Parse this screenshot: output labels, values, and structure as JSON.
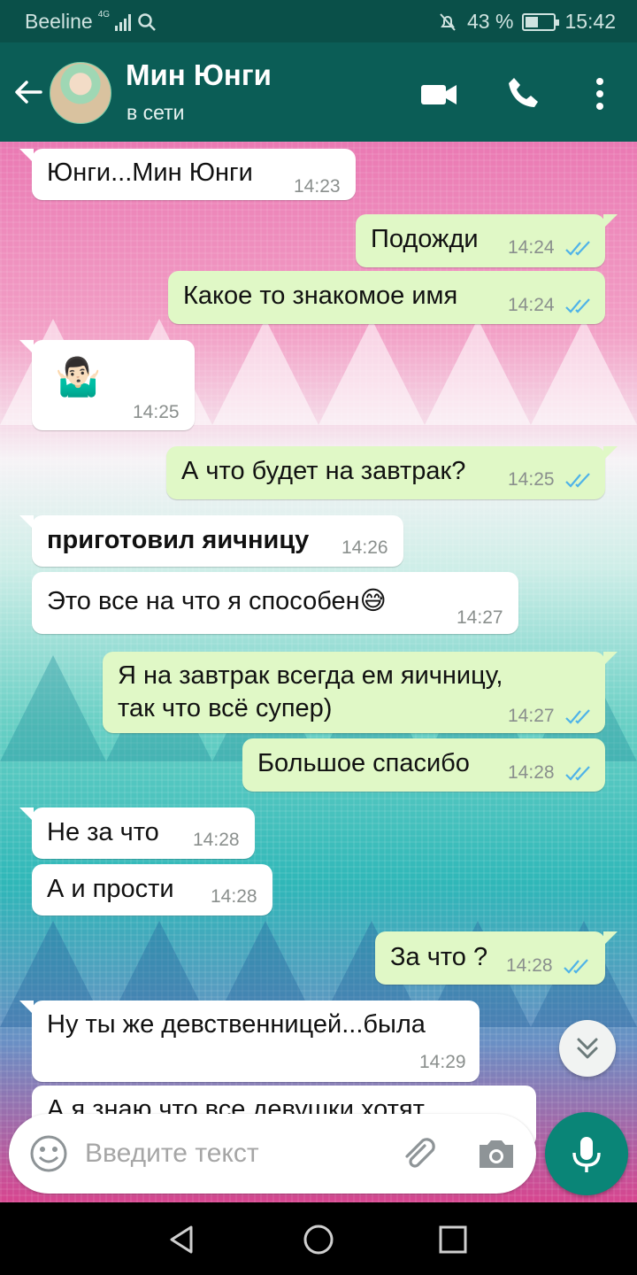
{
  "status_bar": {
    "carrier": "Beeline",
    "network": "4G",
    "battery": "43 %",
    "time": "15:42"
  },
  "header": {
    "name": "Мин Юнги",
    "status": "в сети"
  },
  "messages": [
    {
      "dir": "in",
      "text": "Юнги...Мин Юнги",
      "time": "14:23"
    },
    {
      "dir": "out",
      "text": "Подожди",
      "time": "14:24",
      "read": true
    },
    {
      "dir": "out",
      "text": "Какое то знакомое имя",
      "time": "14:24",
      "read": true
    },
    {
      "dir": "in",
      "text": "🤷🏻‍♂️",
      "time": "14:25"
    },
    {
      "dir": "out",
      "text": "А что будет на завтрак?",
      "time": "14:25",
      "read": true
    },
    {
      "dir": "in",
      "text": "приготовил яичницу",
      "time": "14:26"
    },
    {
      "dir": "in",
      "text": "Это все на что я способен😅",
      "time": "14:27"
    },
    {
      "dir": "out",
      "text_line1": "Я на завтрак всегда ем яичницу,",
      "text_line2": "так что всё супер)",
      "time": "14:27",
      "read": true
    },
    {
      "dir": "out",
      "text": "Большое спасибо",
      "time": "14:28",
      "read": true
    },
    {
      "dir": "in",
      "text": "Не за что",
      "time": "14:28"
    },
    {
      "dir": "in",
      "text": "А и прости",
      "time": "14:28"
    },
    {
      "dir": "out",
      "text": "За что ?",
      "time": "14:28",
      "read": true
    },
    {
      "dir": "in",
      "text": "Ну ты же девственницей...была",
      "time": "14:29"
    },
    {
      "dir": "in",
      "text": "А я знаю что все девушки хотят",
      "time": ""
    }
  ],
  "input": {
    "placeholder": "Введите текст"
  },
  "colors": {
    "header": "#0b5d56",
    "outgoing_bubble": "#e0f8c6",
    "incoming_bubble": "#ffffff",
    "read_ticks": "#4fb3e8",
    "mic_button": "#0a8577"
  },
  "icons": [
    "back-arrow-icon",
    "video-call-icon",
    "phone-icon",
    "more-vert-icon",
    "emoji-icon",
    "attach-icon",
    "camera-icon",
    "mic-icon",
    "chevrons-down-icon",
    "nav-back-icon",
    "nav-home-icon",
    "nav-recents-icon"
  ]
}
